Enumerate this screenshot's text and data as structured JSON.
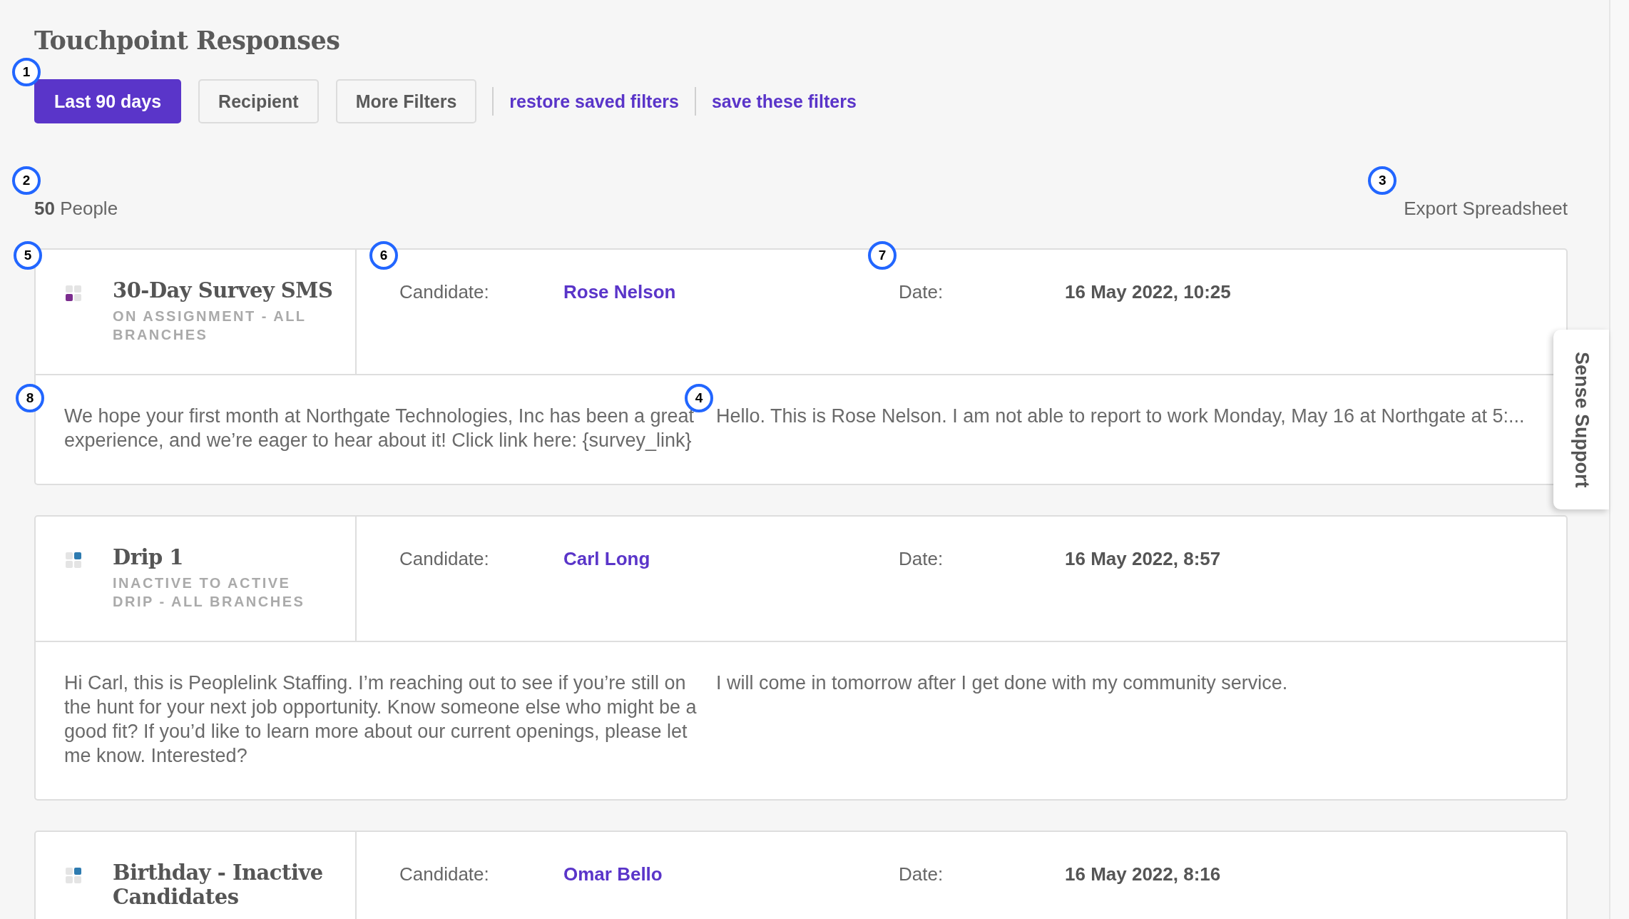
{
  "title": "Touchpoint Responses",
  "filters": {
    "callout": "1",
    "buttons": [
      {
        "label": "Last 90 days",
        "selected": true
      },
      {
        "label": "Recipient",
        "selected": false
      },
      {
        "label": "More Filters",
        "selected": false
      }
    ],
    "links": [
      "restore saved filters",
      "save these filters"
    ]
  },
  "summary": {
    "count": "50",
    "unit": "People",
    "callout": "2"
  },
  "export": {
    "label": "Export Spreadsheet",
    "callout": "3"
  },
  "cards": [
    {
      "campaign": {
        "title": "30-Day Survey SMS",
        "subtitle": "ON ASSIGNMENT - ALL BRANCHES",
        "color": "#7b2d8e",
        "squares": [
          {
            "filled": false
          },
          {
            "filled": false
          },
          {
            "filled": true
          },
          {
            "filled": false
          }
        ],
        "callout": "5"
      },
      "candidate": {
        "label": "Candidate:",
        "name": "Rose Nelson",
        "callout": "6"
      },
      "date": {
        "label": "Date:",
        "value": "16 May 2022, 10:25",
        "callout": "7"
      },
      "message": {
        "text": "We hope your first month at Northgate Technologies, Inc has been a great experience, and we’re eager to hear about it! Click link here: {survey_link}",
        "callout": "8"
      },
      "reply": {
        "text": "Hello. This is Rose Nelson. I am not able to report to work Monday, May 16 at Northgate at 5:...",
        "callout": "4"
      }
    },
    {
      "campaign": {
        "title": "Drip 1",
        "subtitle": "INACTIVE TO ACTIVE DRIP - ALL BRANCHES",
        "color": "#2e7bb0",
        "squares": [
          {
            "filled": false
          },
          {
            "filled": true
          },
          {
            "filled": false
          },
          {
            "filled": false
          }
        ]
      },
      "candidate": {
        "label": "Candidate:",
        "name": "Carl Long"
      },
      "date": {
        "label": "Date:",
        "value": "16 May 2022, 8:57"
      },
      "message": {
        "text": "Hi Carl, this is Peoplelink Staffing. I’m reaching out to see if you’re still on the hunt for your next job opportunity. Know someone else who might be a good fit? If you’d like to learn more about our current openings, please let me know. Interested?"
      },
      "reply": {
        "text": "I will come in tomorrow after I get done with my community service."
      }
    },
    {
      "campaign": {
        "title": "Birthday - Inactive Candidates",
        "color": "#2e7bb0",
        "squares": [
          {
            "filled": false
          },
          {
            "filled": true
          },
          {
            "filled": false
          },
          {
            "filled": false
          }
        ]
      },
      "candidate": {
        "label": "Candidate:",
        "name": "Omar Bello"
      },
      "date": {
        "label": "Date:",
        "value": "16 May 2022, 8:16"
      }
    }
  ],
  "support_tab": {
    "label": "Sense Support"
  }
}
